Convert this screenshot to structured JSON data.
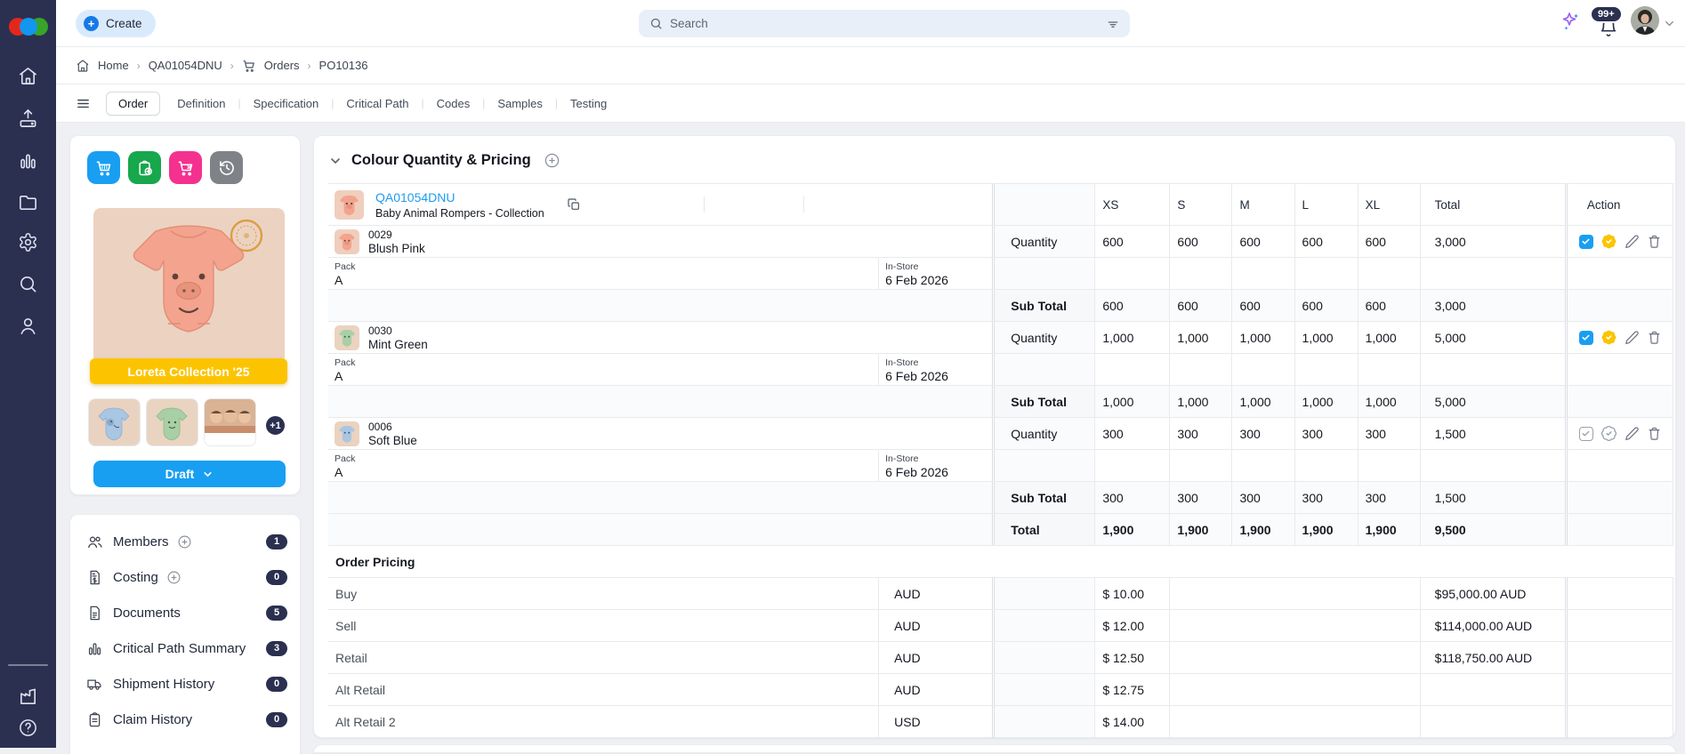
{
  "topbar": {
    "create_label": "Create",
    "search_placeholder": "Search",
    "notification_count": "99+"
  },
  "breadcrumb": {
    "items": [
      "Home",
      "QA01054DNU",
      "Orders",
      "PO10136"
    ]
  },
  "tabs": {
    "items": [
      "Order",
      "Definition",
      "Specification",
      "Critical Path",
      "Codes",
      "Samples",
      "Testing"
    ],
    "active": "Order"
  },
  "left_panel": {
    "banner": "Loreta Collection '25",
    "thumbnails_more": "+1",
    "status_label": "Draft",
    "sections": [
      {
        "label": "Members",
        "count": "1"
      },
      {
        "label": "Costing",
        "count": "0"
      },
      {
        "label": "Documents",
        "count": "5"
      },
      {
        "label": "Critical Path Summary",
        "count": "3"
      },
      {
        "label": "Shipment History",
        "count": "0"
      },
      {
        "label": "Claim History",
        "count": "0"
      }
    ]
  },
  "order_section": {
    "title": "Colour Quantity & Pricing",
    "product": {
      "code": "QA01054DNU",
      "name": "Baby Animal Rompers - Collection"
    },
    "columns": {
      "s0": "XS",
      "s1": "S",
      "s2": "M",
      "s3": "L",
      "s4": "XL",
      "total": "Total",
      "action": "Action"
    },
    "colors": [
      {
        "code": "0029",
        "name": "Blush Pink",
        "row_label": "Quantity",
        "pack_label": "Pack",
        "pack": "A",
        "instore_label": "In-Store",
        "instore": "6 Feb 2026",
        "quantities": [
          "600",
          "600",
          "600",
          "600",
          "600"
        ],
        "quantity_total": "3,000",
        "subtotal_label": "Sub Total",
        "subtotals": [
          "600",
          "600",
          "600",
          "600",
          "600"
        ],
        "subtotal_total": "3,000"
      },
      {
        "code": "0030",
        "name": "Mint Green",
        "row_label": "Quantity",
        "pack_label": "Pack",
        "pack": "A",
        "instore_label": "In-Store",
        "instore": "6 Feb 2026",
        "quantities": [
          "1,000",
          "1,000",
          "1,000",
          "1,000",
          "1,000"
        ],
        "quantity_total": "5,000",
        "subtotal_label": "Sub Total",
        "subtotals": [
          "1,000",
          "1,000",
          "1,000",
          "1,000",
          "1,000"
        ],
        "subtotal_total": "5,000"
      },
      {
        "code": "0006",
        "name": "Soft Blue",
        "row_label": "Quantity",
        "pack_label": "Pack",
        "pack": "A",
        "instore_label": "In-Store",
        "instore": "6 Feb 2026",
        "quantities": [
          "300",
          "300",
          "300",
          "300",
          "300"
        ],
        "quantity_total": "1,500",
        "subtotal_label": "Sub Total",
        "subtotals": [
          "300",
          "300",
          "300",
          "300",
          "300"
        ],
        "subtotal_total": "1,500"
      }
    ],
    "grand_total": {
      "label": "Total",
      "values": [
        "1,900",
        "1,900",
        "1,900",
        "1,900",
        "1,900"
      ],
      "total": "9,500"
    },
    "pricing": {
      "title": "Order Pricing",
      "rows": [
        {
          "label": "Buy",
          "currency": "AUD",
          "price": "$ 10.00",
          "total": "$95,000.00 AUD"
        },
        {
          "label": "Sell",
          "currency": "AUD",
          "price": "$ 12.00",
          "total": "$114,000.00 AUD"
        },
        {
          "label": "Retail",
          "currency": "AUD",
          "price": "$ 12.50",
          "total": "$118,750.00 AUD"
        },
        {
          "label": "Alt Retail",
          "currency": "AUD",
          "price": "$ 12.75",
          "total": ""
        },
        {
          "label": "Alt Retail 2",
          "currency": "USD",
          "price": "$ 14.00",
          "total": ""
        }
      ]
    }
  },
  "icons": [
    "home-icon",
    "upload-icon",
    "analytics-icon",
    "folder-icon",
    "settings-icon",
    "search-icon",
    "profile-icon",
    "factory-icon",
    "help-icon",
    "cart-icon",
    "clipboard-add-icon",
    "cart-remove-icon",
    "history-icon"
  ],
  "colors": {
    "accent_blue": "#1e9bf0",
    "navy": "#2b3050",
    "banner_yellow": "#fcc400",
    "pink": "#f5318f",
    "green": "#17a74c",
    "gray_button": "#7f8388",
    "gold_badge": "#fcc400"
  }
}
